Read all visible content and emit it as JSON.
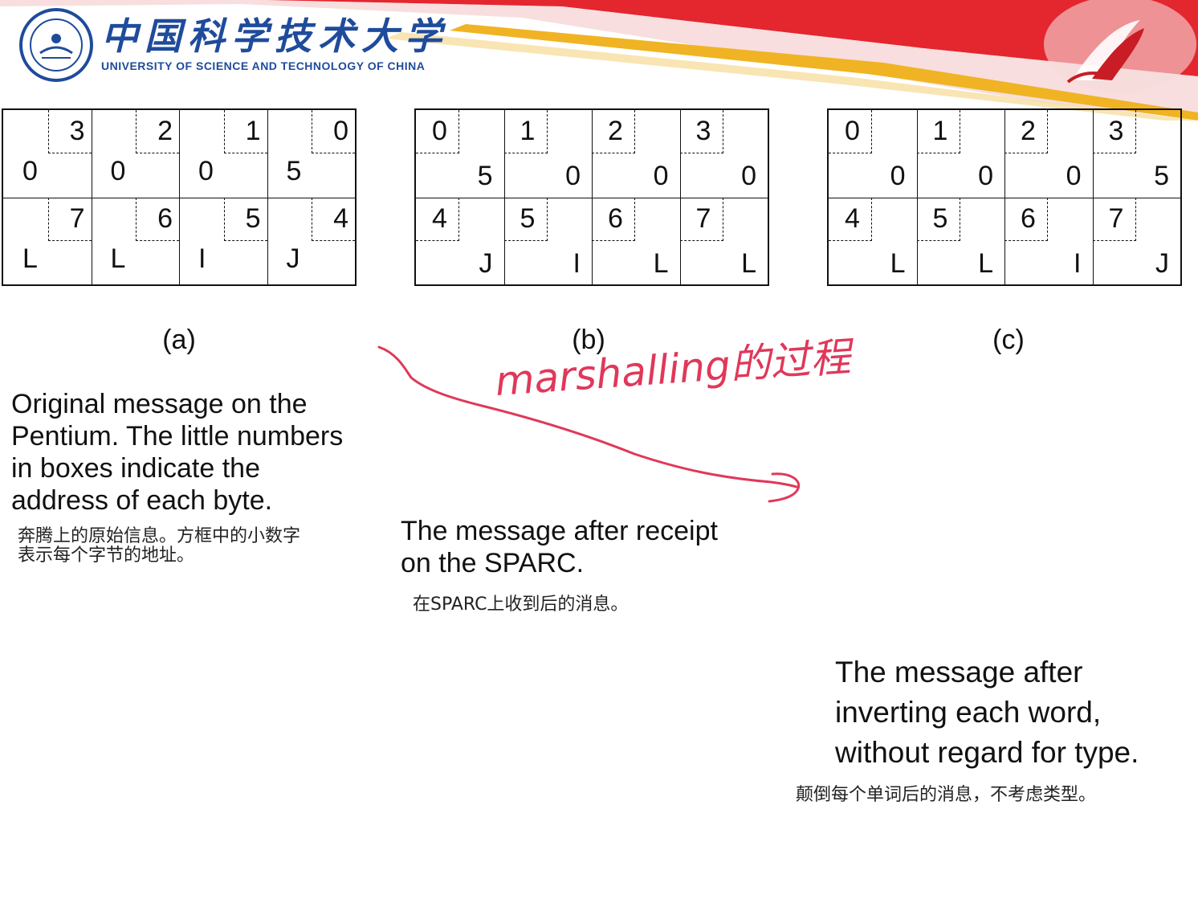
{
  "header": {
    "school_name_cn": "中国科学技术大学",
    "school_name_en": "UNIVERSITY OF SCIENCE AND TECHNOLOGY OF CHINA",
    "colors": {
      "red": "#e4262f",
      "gold": "#f0b323",
      "blue": "#1f4b9c"
    }
  },
  "panels": [
    {
      "caption": "(a)",
      "cells": [
        {
          "addr": "3",
          "val": "0"
        },
        {
          "addr": "2",
          "val": "0"
        },
        {
          "addr": "1",
          "val": "0"
        },
        {
          "addr": "0",
          "val": "5"
        },
        {
          "addr": "7",
          "val": "L"
        },
        {
          "addr": "6",
          "val": "L"
        },
        {
          "addr": "5",
          "val": "I"
        },
        {
          "addr": "4",
          "val": "J"
        }
      ]
    },
    {
      "caption": "(b)",
      "cells": [
        {
          "addr": "0",
          "val": "5"
        },
        {
          "addr": "1",
          "val": "0"
        },
        {
          "addr": "2",
          "val": "0"
        },
        {
          "addr": "3",
          "val": "0"
        },
        {
          "addr": "4",
          "val": "J"
        },
        {
          "addr": "5",
          "val": "I"
        },
        {
          "addr": "6",
          "val": "L"
        },
        {
          "addr": "7",
          "val": "L"
        }
      ]
    },
    {
      "caption": "(c)",
      "cells": [
        {
          "addr": "0",
          "val": "0"
        },
        {
          "addr": "1",
          "val": "0"
        },
        {
          "addr": "2",
          "val": "0"
        },
        {
          "addr": "3",
          "val": "5"
        },
        {
          "addr": "4",
          "val": "L"
        },
        {
          "addr": "5",
          "val": "L"
        },
        {
          "addr": "6",
          "val": "I"
        },
        {
          "addr": "7",
          "val": "J"
        }
      ]
    }
  ],
  "descriptions": {
    "a_en": [
      "Original message on the",
      "Pentium. The little numbers",
      "in boxes indicate the",
      "address of each byte."
    ],
    "a_cn": [
      "奔腾上的原始信息。方框中的小数字",
      "表示每个字节的地址。"
    ],
    "b_en": [
      "The message after receipt",
      "on the SPARC."
    ],
    "b_cn": "在SPARC上收到后的消息。",
    "c_en": [
      "The message after",
      "inverting each word,",
      "without regard for type."
    ],
    "c_cn": "颠倒每个单词后的消息，不考虑类型。"
  },
  "annotation": {
    "handwritten_text": "marshalling的过程",
    "ink_color": "#e0385a"
  }
}
